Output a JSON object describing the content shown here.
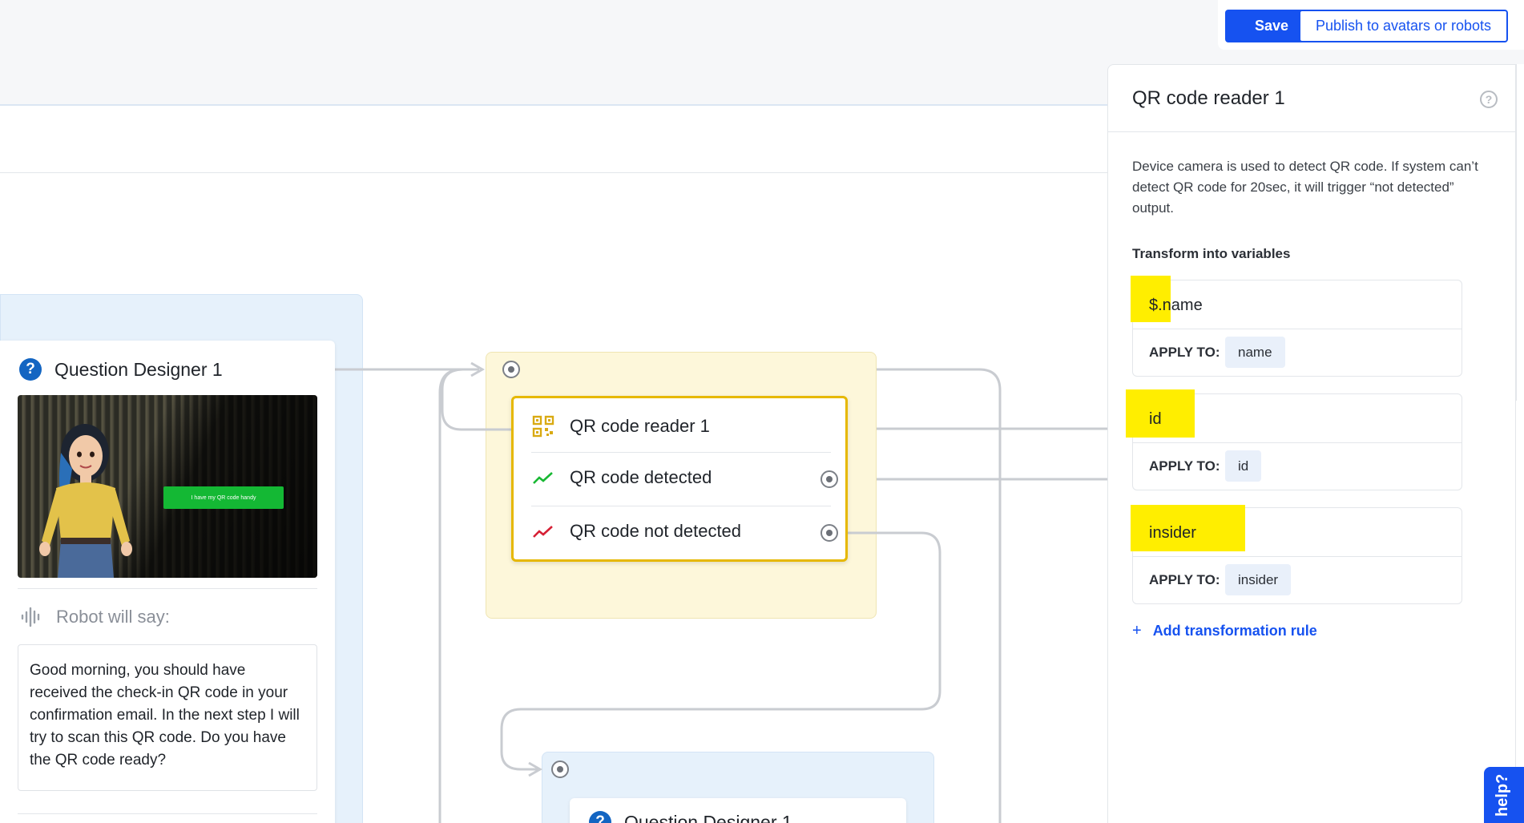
{
  "toolbar": {
    "save_label": "Save",
    "publish_label": "Publish to avatars or robots"
  },
  "canvas": {
    "question_node": {
      "title": "Question Designer 1",
      "image_button_label": "I have my QR code handy",
      "robot_label": "Robot will say:",
      "speech": "Good morning, you should have received the check-in QR code in your confirmation email. In the next step I will try to scan this QR code. Do you have the QR code ready?"
    },
    "qr_node": {
      "title": "QR code reader 1",
      "outputs": [
        {
          "label": "QR code detected",
          "color": "#18b833"
        },
        {
          "label": "QR code not detected",
          "color": "#d62035"
        }
      ]
    },
    "question_node_2": {
      "title": "Question Designer 1"
    }
  },
  "panel": {
    "title": "QR code reader 1",
    "description": "Device camera is used to detect QR code. If system can’t detect QR code for 20sec, it will trigger “not detected” output.",
    "subtitle": "Transform into variables",
    "apply_label": "APPLY TO:",
    "rules": [
      {
        "variable": "$.name",
        "apply_to": "name"
      },
      {
        "variable": "id",
        "apply_to": "id"
      },
      {
        "variable": "insider",
        "apply_to": "insider"
      }
    ],
    "add_rule_label": "Add transformation rule"
  },
  "help_tab": {
    "label": "help?"
  },
  "colors": {
    "primary": "#1652f0",
    "node_border": "#e6b800",
    "highlight": "#ffee00"
  }
}
